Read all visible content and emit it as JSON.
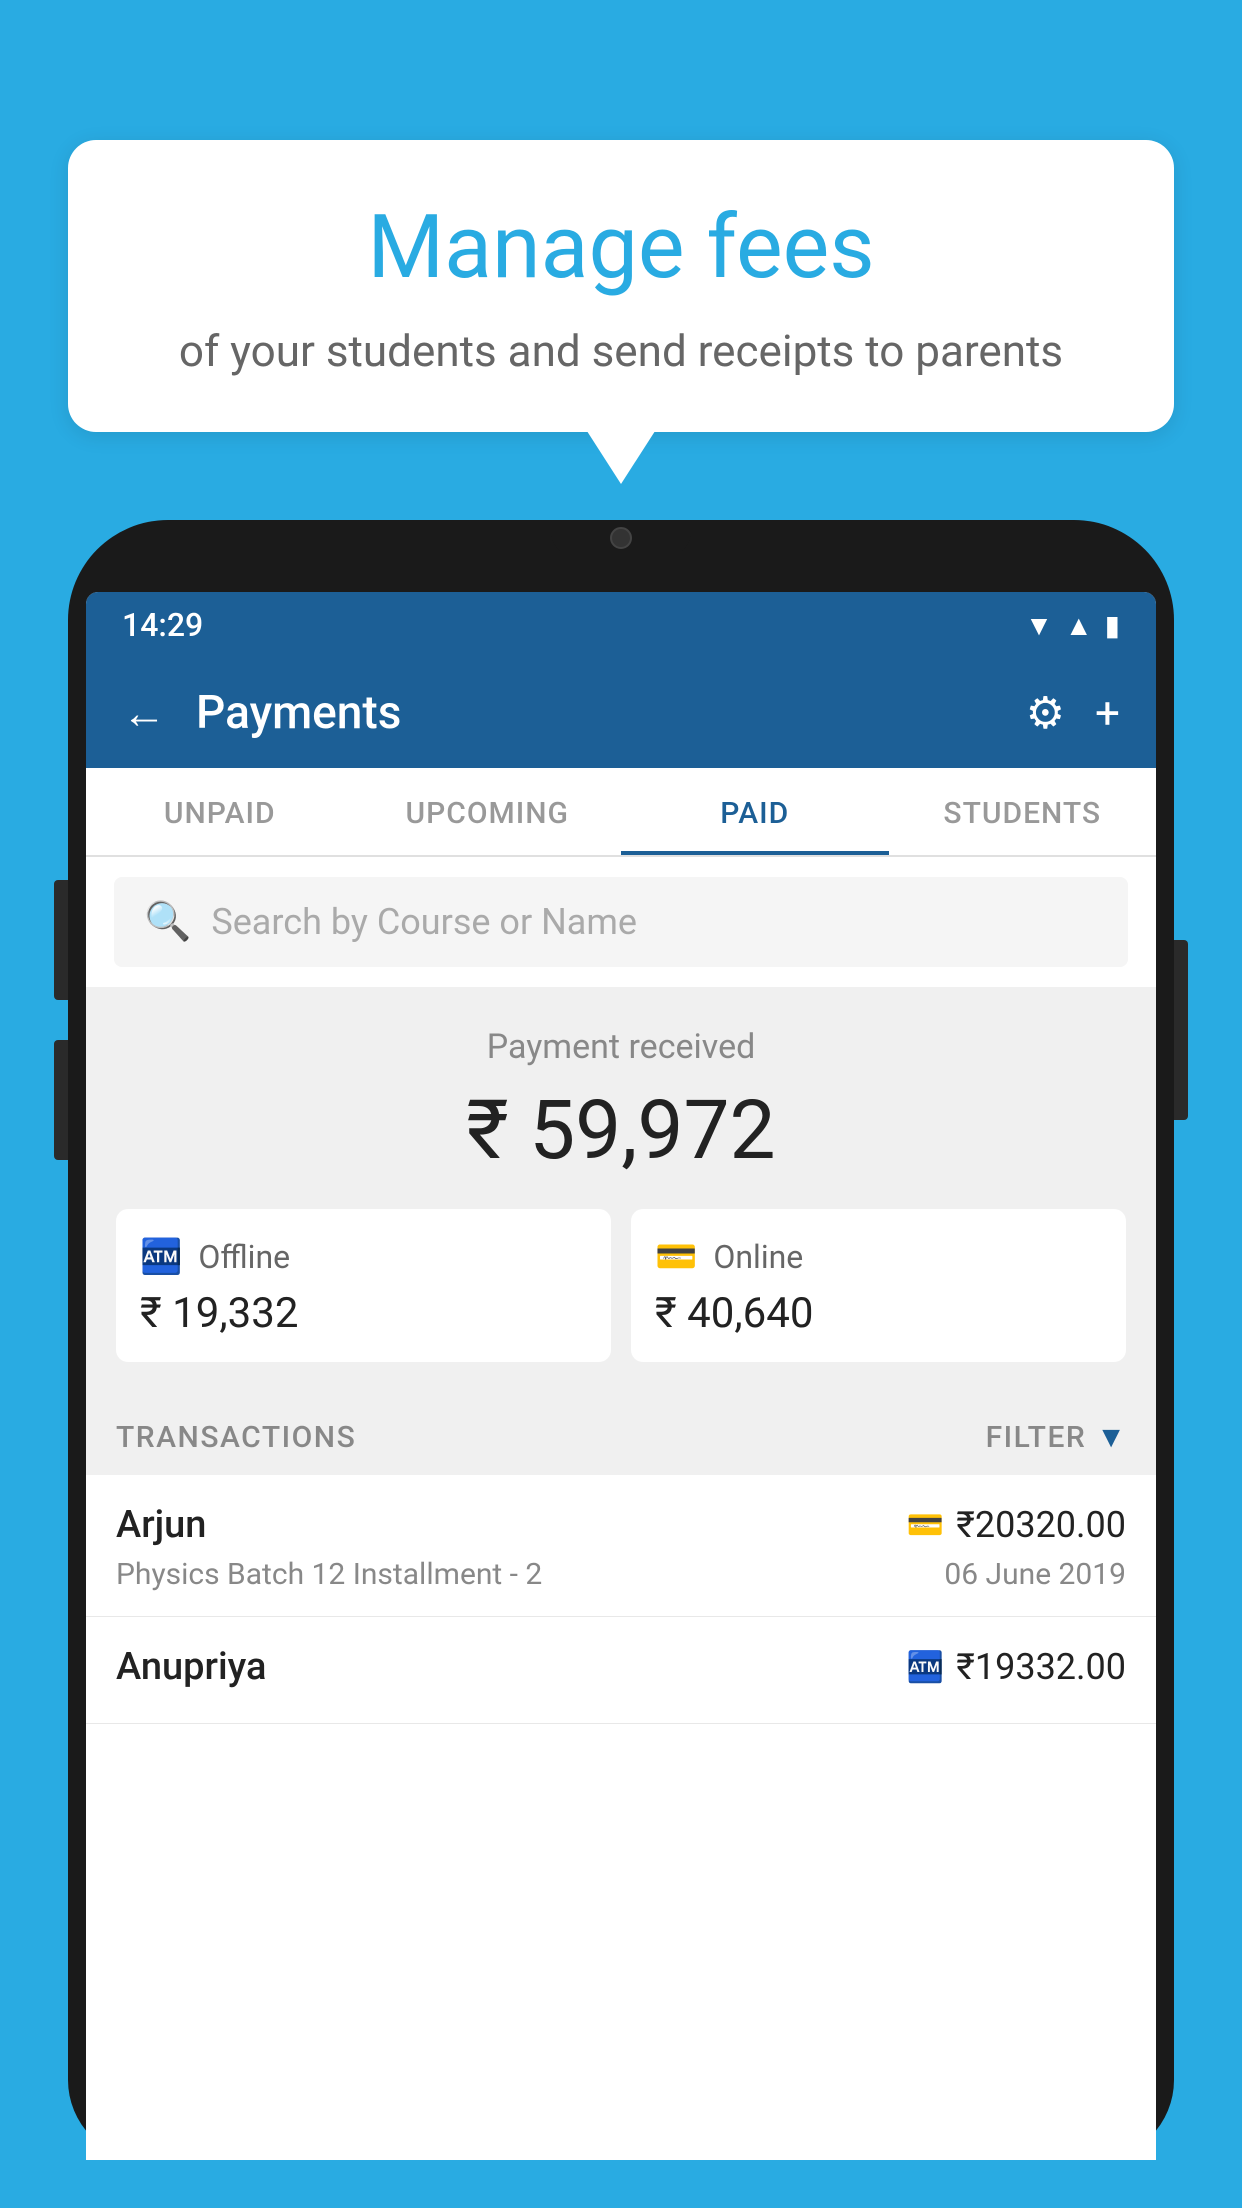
{
  "background_color": "#29ABE2",
  "bubble": {
    "title": "Manage fees",
    "subtitle": "of your students and send receipts to parents"
  },
  "status_bar": {
    "time": "14:29",
    "icons": [
      "wifi",
      "signal",
      "battery"
    ]
  },
  "app_bar": {
    "title": "Payments",
    "back_label": "←",
    "gear_label": "⚙",
    "plus_label": "+"
  },
  "tabs": [
    {
      "label": "UNPAID",
      "active": false
    },
    {
      "label": "UPCOMING",
      "active": false
    },
    {
      "label": "PAID",
      "active": true
    },
    {
      "label": "STUDENTS",
      "active": false
    }
  ],
  "search": {
    "placeholder": "Search by Course or Name"
  },
  "payment_summary": {
    "label": "Payment received",
    "total_amount": "₹ 59,972",
    "offline": {
      "type": "Offline",
      "amount": "₹ 19,332"
    },
    "online": {
      "type": "Online",
      "amount": "₹ 40,640"
    }
  },
  "transactions": {
    "header": "TRANSACTIONS",
    "filter_label": "FILTER",
    "items": [
      {
        "name": "Arjun",
        "course": "Physics Batch 12 Installment - 2",
        "amount": "₹20320.00",
        "date": "06 June 2019",
        "payment_type": "online"
      },
      {
        "name": "Anupriya",
        "course": "",
        "amount": "₹19332.00",
        "date": "",
        "payment_type": "offline"
      }
    ]
  }
}
